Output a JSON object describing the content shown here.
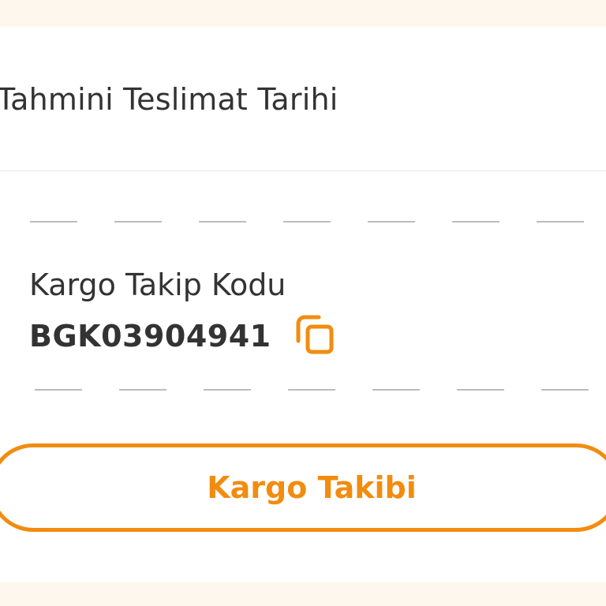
{
  "delivery": {
    "label": "Tahmini Teslimat Tarihi"
  },
  "tracking": {
    "label": "Kargo Takip Kodu",
    "code": "BGK03904941",
    "copy_icon": "copy-icon"
  },
  "actions": {
    "track_button_label": "Kargo Takibi"
  },
  "colors": {
    "accent": "#f28c0f",
    "text": "#333333",
    "background": "#fdf7ee",
    "divider": "#bdbdbd"
  }
}
